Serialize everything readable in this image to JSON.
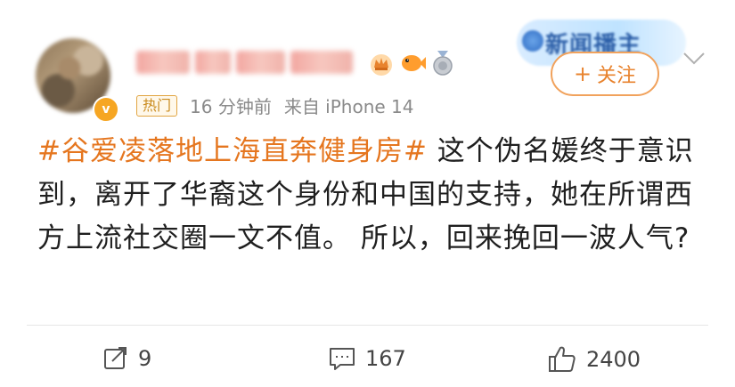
{
  "post": {
    "meta": {
      "hot_tag": "热门",
      "time": "16 分钟前",
      "source": "来自 iPhone 14"
    },
    "follow_label": "关注",
    "follow_plus": "+",
    "promo_text": "新闻播主",
    "hashtag": "#谷爱凌落地上海直奔健身房#",
    "content": "  这个伪名媛终于意识到，离开了华裔这个身份和中国的支持，她在所谓西方上流社交圈一文不值。 所以，回来挽回一波人气?",
    "actions": {
      "share_count": "9",
      "comment_count": "167",
      "like_count": "2400"
    }
  },
  "colors": {
    "accent": "#e5761f",
    "follow_border": "#f1a25c",
    "meta_gray": "#8a8a8a"
  },
  "icons": [
    "verified-badge-icon",
    "crown-icon",
    "fish-icon",
    "medal-icon",
    "chevron-down-icon",
    "share-icon",
    "comment-icon",
    "like-icon"
  ]
}
